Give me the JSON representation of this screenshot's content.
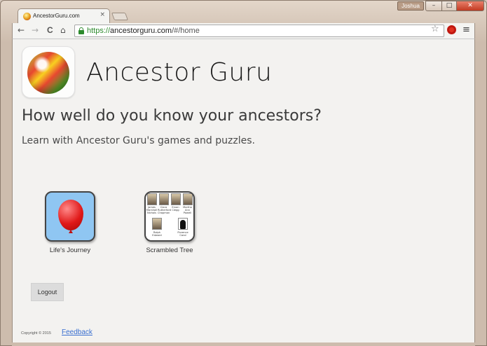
{
  "browser": {
    "tab": {
      "title": "AncestorGuru.com",
      "close_label": "×"
    },
    "user_badge": "Joshua",
    "window_controls": {
      "minimize": "–",
      "maximize": "□",
      "close": "✕"
    },
    "toolbar": {
      "back_icon": "←",
      "forward_icon": "→",
      "reload_icon": "C",
      "home_icon": "⌂",
      "url_scheme": "https://",
      "url_host": "ancestorguru.com",
      "url_path": "/#/home",
      "star_icon": "☆",
      "menu_icon": "≡"
    }
  },
  "page": {
    "site_title": "Ancestor Guru",
    "headline": "How well do you know your ancestors?",
    "subline": "Learn with Ancestor Guru's games and puzzles.",
    "games": [
      {
        "label": "Life's Journey"
      },
      {
        "label": "Scrambled Tree"
      }
    ],
    "tree_names": {
      "top": [
        "James",
        "Clara",
        "Ervan",
        "Martha"
      ],
      "top2": [
        "Marshall",
        "Rutherford",
        "Clegg",
        "Ann"
      ],
      "top3": [
        "Nichols",
        "Chapman",
        "",
        "Powell"
      ],
      "bottom_left": [
        "Ralph",
        "Edward"
      ],
      "bottom_right": [
        "Florence",
        "Carol"
      ]
    },
    "logout_label": "Logout",
    "footer": {
      "copyright": "Copyright © 2015",
      "feedback_label": "Feedback"
    }
  },
  "colors": {
    "link": "#3a6fd0",
    "secure_green": "#2d8a2d",
    "page_bg": "#f3f2f0",
    "journey_tile_bg": "#8fc6f2"
  }
}
